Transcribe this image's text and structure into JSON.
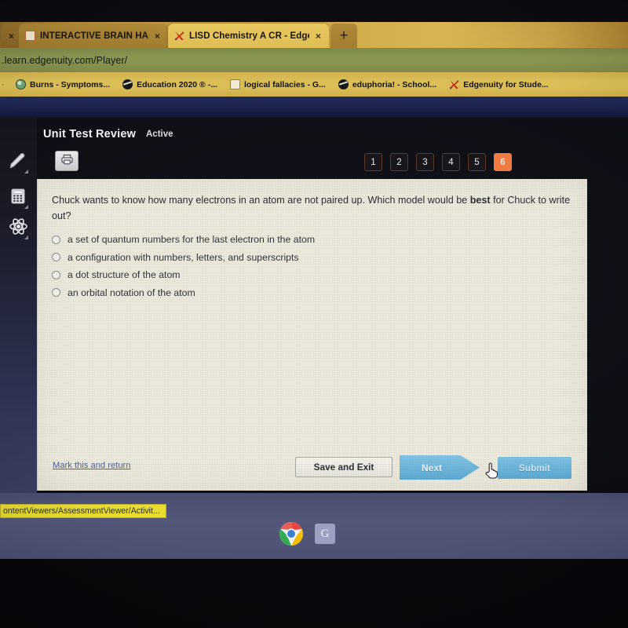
{
  "browser": {
    "tabs": [
      {
        "title": "",
        "favicon": "none",
        "state": "partial-left",
        "close_label": "×"
      },
      {
        "title": "INTERACTIVE BRAIN HANDOUT",
        "favicon": "page-icon",
        "state": "inactive",
        "close_label": "×"
      },
      {
        "title": "LISD Chemistry A CR - Edgenuity",
        "favicon": "edgenuity-x-icon",
        "state": "active",
        "close_label": "×"
      }
    ],
    "new_tab_label": "+",
    "url": ".learn.edgenuity.com/Player/",
    "bookmarks": [
      {
        "label": "Burns - Symptoms...",
        "icon": "globe-icon"
      },
      {
        "label": "Education 2020 ® -...",
        "icon": "globe-dark-icon"
      },
      {
        "label": "logical fallacies - G...",
        "icon": "page-icon"
      },
      {
        "label": "eduphoria! - School...",
        "icon": "globe-dark-icon"
      },
      {
        "label": "Edgenuity for Stude...",
        "icon": "edgenuity-x-icon"
      }
    ]
  },
  "app": {
    "title": "Unit Test Review",
    "status": "Active",
    "print_icon": "printer-icon",
    "rail": [
      {
        "icon": "highlighter-icon",
        "name": "highlighter-tool"
      },
      {
        "icon": "calculator-icon",
        "name": "calculator-tool"
      },
      {
        "icon": "atom-icon",
        "name": "periodic-table-tool"
      }
    ],
    "pager": {
      "items": [
        "1",
        "2",
        "3",
        "4",
        "5",
        "6"
      ],
      "current": "6",
      "current_color": "#ef7a42"
    },
    "question": {
      "text_before_bold": "Chuck wants to know how many electrons in an atom are not paired up. Which model would be ",
      "bold": "best",
      "text_after_bold": " for Chuck to write out?"
    },
    "options": [
      {
        "label": "a set of quantum numbers for the last electron in the atom",
        "selected": false
      },
      {
        "label": "a configuration with numbers, letters, and superscripts",
        "selected": false
      },
      {
        "label": "a dot structure of the atom",
        "selected": false
      },
      {
        "label": "an orbital notation of the atom",
        "selected": false
      }
    ],
    "footer": {
      "mark_link": "Mark this and return",
      "save_exit": "Save and Exit",
      "next": "Next",
      "submit": "Submit",
      "next_color": "#5aa9d4",
      "submit_color": "#58a7d2"
    }
  },
  "os": {
    "status_url": "ontentViewers/AssessmentViewer/Activit...",
    "status_url_color": "#e8dd2e",
    "taskbar": [
      {
        "name": "chrome-icon",
        "label": ""
      },
      {
        "name": "google-icon",
        "label": "G"
      }
    ]
  }
}
